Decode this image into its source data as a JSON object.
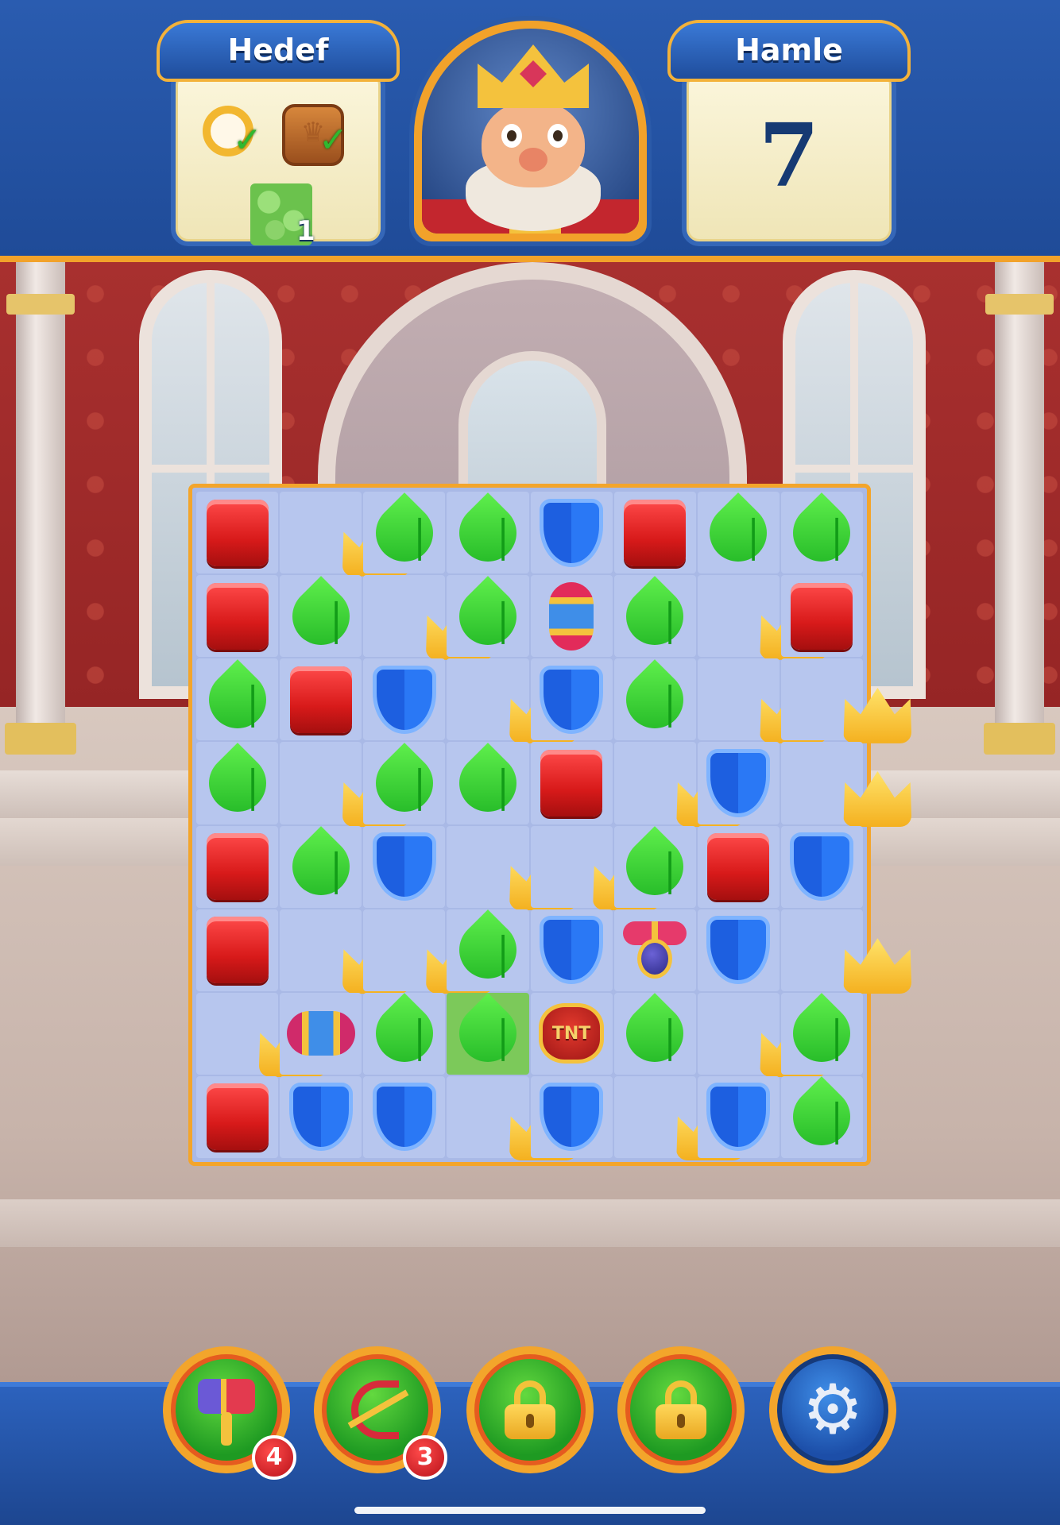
{
  "header": {
    "goal_title": "Hedef",
    "goal_items": [
      {
        "icon": "ring-goal-icon",
        "done": true
      },
      {
        "icon": "wooden-box-goal-icon",
        "done": true
      },
      {
        "icon": "grass-goal-icon",
        "count": "1"
      }
    ],
    "moves_title": "Hamle",
    "moves_value": "7",
    "portrait": "king-portrait"
  },
  "board": {
    "rows": [
      [
        "box",
        "crown",
        "leaf",
        "leaf",
        "shield",
        "box",
        "leaf",
        "leaf"
      ],
      [
        "box",
        "leaf",
        "crown",
        "leaf",
        "rocket-v",
        "leaf",
        "crown",
        "box"
      ],
      [
        "leaf",
        "box",
        "shield",
        "crown",
        "shield",
        "leaf",
        "crown",
        "crown"
      ],
      [
        "leaf",
        "crown",
        "leaf",
        "leaf",
        "box",
        "crown",
        "shield",
        "crown"
      ],
      [
        "box",
        "leaf",
        "shield",
        "crown",
        "crown",
        "leaf",
        "box",
        "shield"
      ],
      [
        "box",
        "crown",
        "crown",
        "leaf",
        "shield",
        "propeller",
        "shield",
        "crown"
      ],
      [
        "crown",
        "rocket-h",
        "leaf",
        "leaf-grass",
        "tnt",
        "leaf",
        "crown",
        "leaf"
      ],
      [
        "box",
        "shield",
        "shield",
        "crown",
        "shield",
        "crown",
        "shield",
        "leaf"
      ]
    ],
    "tnt_label": "TNT"
  },
  "boosters": [
    {
      "name": "hammer",
      "count": "4",
      "locked": false
    },
    {
      "name": "arrow",
      "count": "3",
      "locked": false
    },
    {
      "name": "locked-slot-1",
      "locked": true
    },
    {
      "name": "locked-slot-2",
      "locked": true
    },
    {
      "name": "settings",
      "locked": false
    }
  ],
  "colors": {
    "header_blue": "#1f4f9e",
    "frame_orange": "#f3a52b",
    "board_bg": "#a9b9e6"
  }
}
